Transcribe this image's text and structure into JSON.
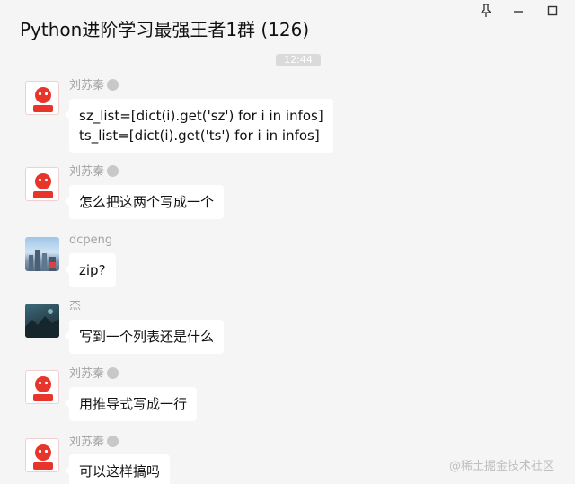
{
  "window": {
    "title": "Python进阶学习最强王者1群 (126)",
    "pin_icon": "pin-icon",
    "minimize_icon": "minimize-icon",
    "maximize_icon": "maximize-icon"
  },
  "timestamp": "12:44",
  "messages": [
    {
      "sender": "刘苏秦",
      "avatar": "red-logo-avatar",
      "lines": [
        "sz_list=[dict(i).get('sz') for i in infos]",
        "ts_list=[dict(i).get('ts') for i in infos]"
      ]
    },
    {
      "sender": "刘苏秦",
      "avatar": "red-logo-avatar",
      "lines": [
        "怎么把这两个写成一个"
      ]
    },
    {
      "sender": "dcpeng",
      "avatar": "city-photo-avatar",
      "lines": [
        "zip?"
      ]
    },
    {
      "sender": "杰",
      "avatar": "landscape-photo-avatar",
      "lines": [
        "写到一个列表还是什么"
      ]
    },
    {
      "sender": "刘苏秦",
      "avatar": "red-logo-avatar",
      "lines": [
        "用推导式写成一行"
      ]
    },
    {
      "sender": "刘苏秦",
      "avatar": "red-logo-avatar",
      "lines": [
        "可以这样搞吗"
      ]
    }
  ],
  "watermark": "@稀土掘金技术社区",
  "colors": {
    "background": "#f5f5f5",
    "bubble": "#ffffff",
    "sender_name": "#a3a3a3",
    "avatar_red": "#e8352b"
  }
}
